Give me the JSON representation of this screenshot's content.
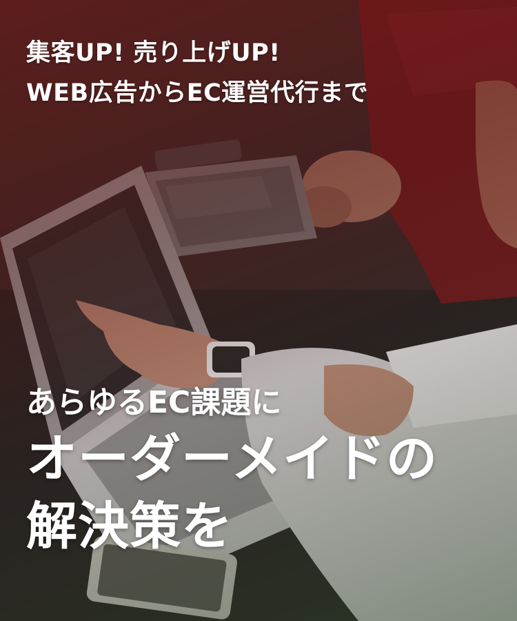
{
  "tagline": {
    "line1": "集客UP! 売り上げUP!",
    "line2": "WEB広告からEC運営代行まで"
  },
  "headline": {
    "line1": "あらゆるEC課題に",
    "line2": "オーダーメイドの",
    "line3": "解決策を"
  },
  "colors": {
    "text": "#ffffff",
    "tint_top": "#7a1414",
    "tint_bottom": "#2e4a2e"
  }
}
